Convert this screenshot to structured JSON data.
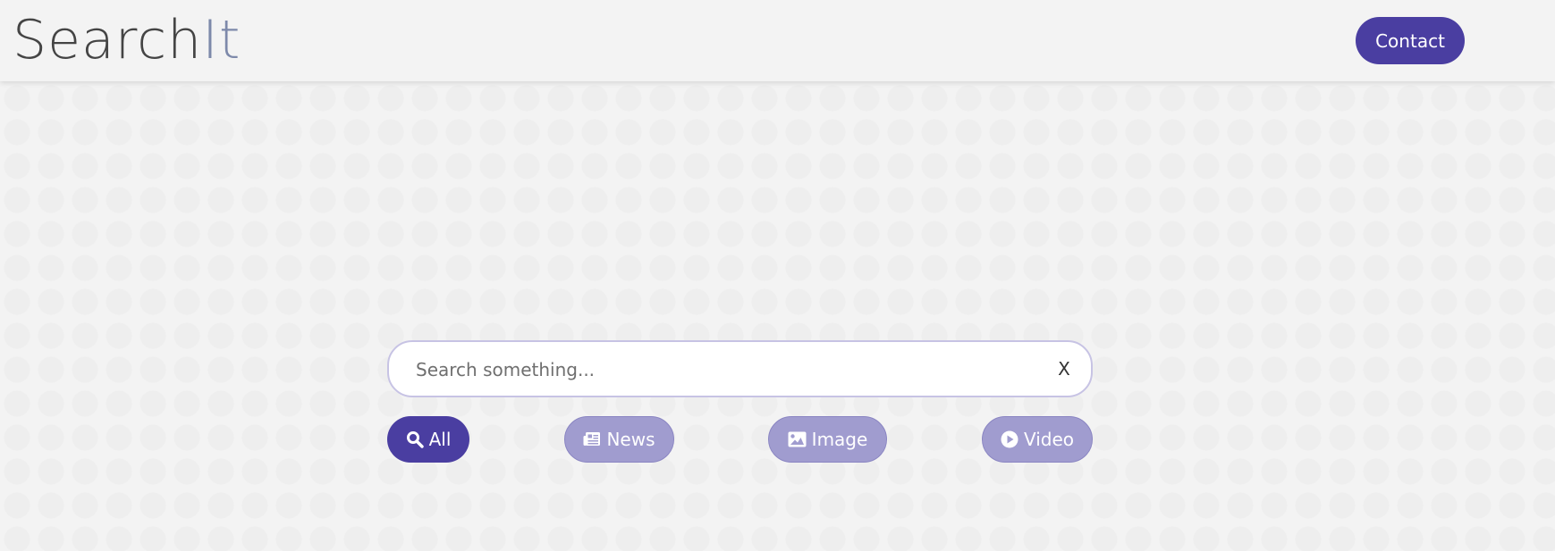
{
  "header": {
    "logo_part1": "Search",
    "logo_part2": "It",
    "contact_label": "Contact"
  },
  "search": {
    "placeholder": "Search something...",
    "value": "",
    "clear_label": "X"
  },
  "filters": [
    {
      "label": "All",
      "icon": "search-icon",
      "active": true
    },
    {
      "label": "News",
      "icon": "newspaper-icon",
      "active": false
    },
    {
      "label": "Image",
      "icon": "image-icon",
      "active": false
    },
    {
      "label": "Video",
      "icon": "play-circle-icon",
      "active": false
    }
  ],
  "colors": {
    "accent": "#4a3ea1",
    "inactive": "#a09ccf",
    "background": "#f3f3f3",
    "logo_dark": "#444444",
    "logo_light": "#7d89aa"
  }
}
